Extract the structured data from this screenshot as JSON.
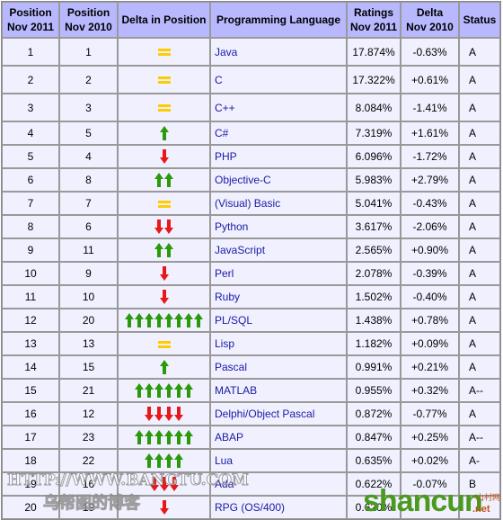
{
  "headers": [
    "Position\nNov 2011",
    "Position\nNov 2010",
    "Delta in Position",
    "Programming Language",
    "Ratings\nNov 2011",
    "Delta\nNov 2010",
    "Status"
  ],
  "colors": {
    "header_bg": "#b8b8ff",
    "row_bg": "#f0f0ff",
    "link": "#1a1aa6",
    "up": "#2a9a0a",
    "down": "#e81818",
    "same": "#ffcc00"
  },
  "rows": [
    {
      "pos2011": "1",
      "pos2010": "1",
      "delta": {
        "dir": "same",
        "count": 1
      },
      "lang": "Java",
      "rating": "17.874%",
      "change": "-0.63%",
      "status": "A"
    },
    {
      "pos2011": "2",
      "pos2010": "2",
      "delta": {
        "dir": "same",
        "count": 1
      },
      "lang": "C",
      "rating": "17.322%",
      "change": "+0.61%",
      "status": "A"
    },
    {
      "pos2011": "3",
      "pos2010": "3",
      "delta": {
        "dir": "same",
        "count": 1
      },
      "lang": "C++",
      "rating": "8.084%",
      "change": "-1.41%",
      "status": "A"
    },
    {
      "pos2011": "4",
      "pos2010": "5",
      "delta": {
        "dir": "up",
        "count": 1
      },
      "lang": "C#",
      "rating": "7.319%",
      "change": "+1.61%",
      "status": "A"
    },
    {
      "pos2011": "5",
      "pos2010": "4",
      "delta": {
        "dir": "down",
        "count": 1
      },
      "lang": "PHP",
      "rating": "6.096%",
      "change": "-1.72%",
      "status": "A"
    },
    {
      "pos2011": "6",
      "pos2010": "8",
      "delta": {
        "dir": "up",
        "count": 2
      },
      "lang": "Objective-C",
      "rating": "5.983%",
      "change": "+2.79%",
      "status": "A"
    },
    {
      "pos2011": "7",
      "pos2010": "7",
      "delta": {
        "dir": "same",
        "count": 1
      },
      "lang": "(Visual) Basic",
      "rating": "5.041%",
      "change": "-0.43%",
      "status": "A"
    },
    {
      "pos2011": "8",
      "pos2010": "6",
      "delta": {
        "dir": "down",
        "count": 2
      },
      "lang": "Python",
      "rating": "3.617%",
      "change": "-2.06%",
      "status": "A"
    },
    {
      "pos2011": "9",
      "pos2010": "11",
      "delta": {
        "dir": "up",
        "count": 2
      },
      "lang": "JavaScript",
      "rating": "2.565%",
      "change": "+0.90%",
      "status": "A"
    },
    {
      "pos2011": "10",
      "pos2010": "9",
      "delta": {
        "dir": "down",
        "count": 1
      },
      "lang": "Perl",
      "rating": "2.078%",
      "change": "-0.39%",
      "status": "A"
    },
    {
      "pos2011": "11",
      "pos2010": "10",
      "delta": {
        "dir": "down",
        "count": 1
      },
      "lang": "Ruby",
      "rating": "1.502%",
      "change": "-0.40%",
      "status": "A"
    },
    {
      "pos2011": "12",
      "pos2010": "20",
      "delta": {
        "dir": "up",
        "count": 8
      },
      "lang": "PL/SQL",
      "rating": "1.438%",
      "change": "+0.78%",
      "status": "A"
    },
    {
      "pos2011": "13",
      "pos2010": "13",
      "delta": {
        "dir": "same",
        "count": 1
      },
      "lang": "Lisp",
      "rating": "1.182%",
      "change": "+0.09%",
      "status": "A"
    },
    {
      "pos2011": "14",
      "pos2010": "15",
      "delta": {
        "dir": "up",
        "count": 1
      },
      "lang": "Pascal",
      "rating": "0.991%",
      "change": "+0.21%",
      "status": "A"
    },
    {
      "pos2011": "15",
      "pos2010": "21",
      "delta": {
        "dir": "up",
        "count": 6
      },
      "lang": "MATLAB",
      "rating": "0.955%",
      "change": "+0.32%",
      "status": "A--"
    },
    {
      "pos2011": "16",
      "pos2010": "12",
      "delta": {
        "dir": "down",
        "count": 4
      },
      "lang": "Delphi/Object Pascal",
      "rating": "0.872%",
      "change": "-0.77%",
      "status": "A"
    },
    {
      "pos2011": "17",
      "pos2010": "23",
      "delta": {
        "dir": "up",
        "count": 6
      },
      "lang": "ABAP",
      "rating": "0.847%",
      "change": "+0.25%",
      "status": "A--"
    },
    {
      "pos2011": "18",
      "pos2010": "22",
      "delta": {
        "dir": "up",
        "count": 4
      },
      "lang": "Lua",
      "rating": "0.635%",
      "change": "+0.02%",
      "status": "A-"
    },
    {
      "pos2011": "19",
      "pos2010": "16",
      "delta": {
        "dir": "down",
        "count": 3
      },
      "lang": "Ada",
      "rating": "0.622%",
      "change": "-0.07%",
      "status": "B"
    },
    {
      "pos2011": "20",
      "pos2010": "19",
      "delta": {
        "dir": "down",
        "count": 1
      },
      "lang": "RPG (OS/400)",
      "rating": "0.620%",
      "change": "",
      "status": ""
    }
  ],
  "watermarks": {
    "url": "HTTP://WWW.BANGTU.COM",
    "blog": "乌帮图的博客",
    "site": "shancun",
    "site_cn": "山村网",
    "site_tld": ".net"
  }
}
